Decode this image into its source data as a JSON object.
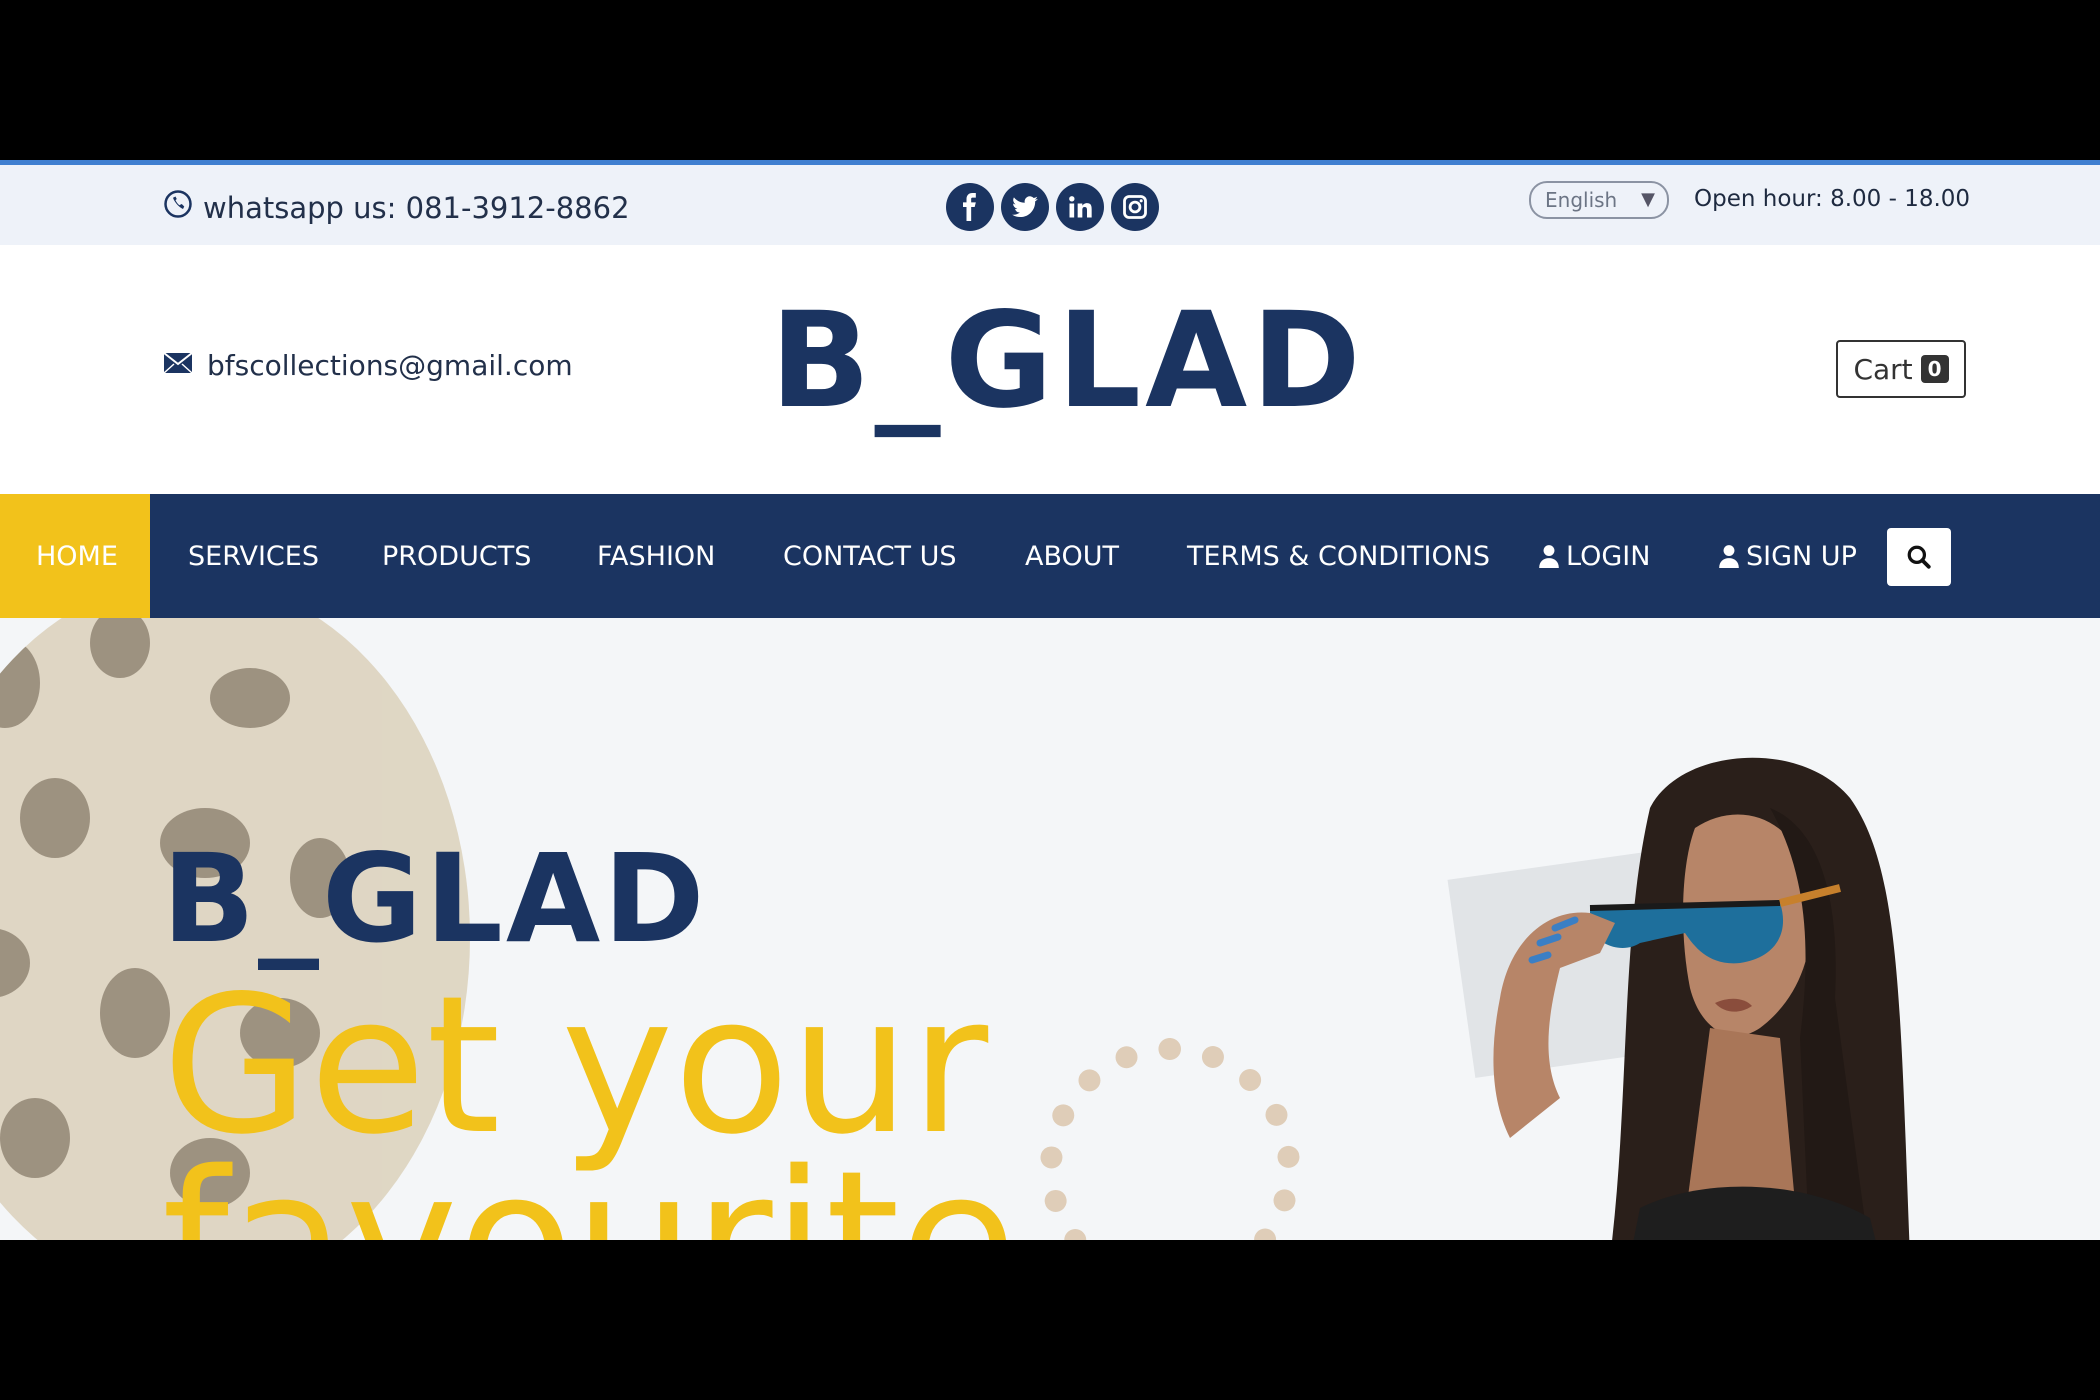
{
  "topbar": {
    "whatsapp_text": "whatsapp us: 081-3912-8862",
    "socials": [
      "facebook",
      "twitter",
      "linkedin",
      "instagram"
    ],
    "language": "English",
    "open_hours": "Open hour: 8.00 - 18.00"
  },
  "header": {
    "email": "bfscollections@gmail.com",
    "logo": "B_GLAD",
    "cart_label": "Cart",
    "cart_count": "0"
  },
  "nav": {
    "items": [
      "HOME",
      "SERVICES",
      "PRODUCTS",
      "FASHION",
      "CONTACT US",
      "ABOUT",
      "TERMS & CONDITIONS",
      "LOGIN",
      "SIGN UP"
    ]
  },
  "hero": {
    "brand": "B_GLAD",
    "headline": "Get your favourite"
  },
  "colors": {
    "navy": "#1b3461",
    "accent_yellow": "#f2c21b",
    "topbar_bg": "#eef2f9",
    "topbar_border": "#3f7fd0"
  }
}
